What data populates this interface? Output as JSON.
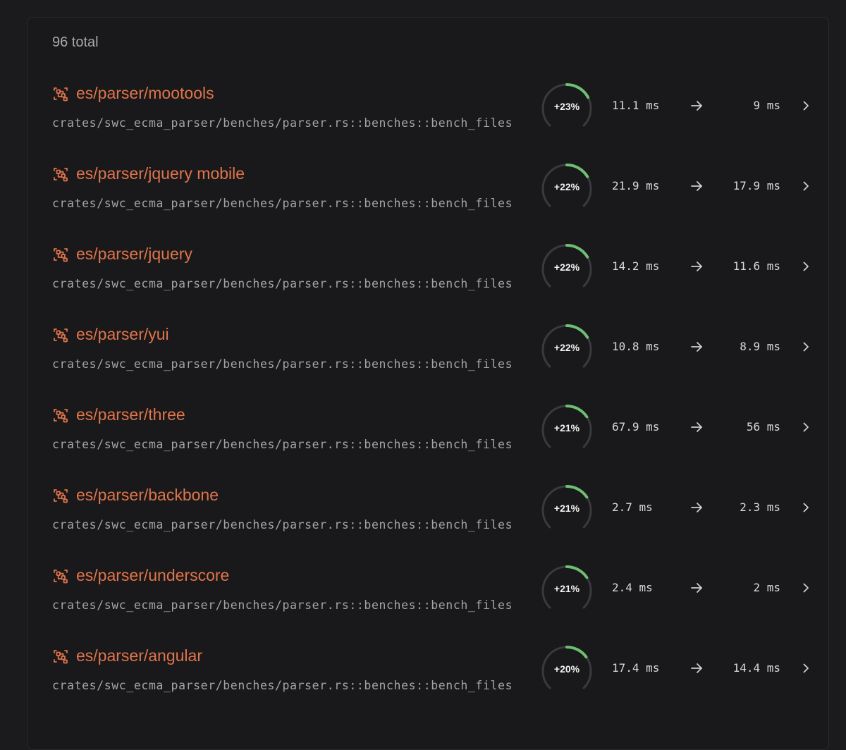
{
  "summary": {
    "total_label": "96 total"
  },
  "colors": {
    "accent": "#e0744a",
    "gauge_fill": "#6fbf73",
    "gauge_track": "#3a3a3e"
  },
  "icons": {
    "bench": "benchmark-icon",
    "arrow": "arrow-right-icon",
    "chevron": "chevron-right-icon"
  },
  "benchmarks": [
    {
      "name": "es/parser/mootools",
      "path": "crates/swc_ecma_parser/benches/parser.rs::benches::bench_files",
      "change": "+23%",
      "change_fraction": 0.23,
      "before": "11.1 ms",
      "after": "9 ms"
    },
    {
      "name": "es/parser/jquery mobile",
      "path": "crates/swc_ecma_parser/benches/parser.rs::benches::bench_files",
      "change": "+22%",
      "change_fraction": 0.22,
      "before": "21.9 ms",
      "after": "17.9 ms"
    },
    {
      "name": "es/parser/jquery",
      "path": "crates/swc_ecma_parser/benches/parser.rs::benches::bench_files",
      "change": "+22%",
      "change_fraction": 0.22,
      "before": "14.2 ms",
      "after": "11.6 ms"
    },
    {
      "name": "es/parser/yui",
      "path": "crates/swc_ecma_parser/benches/parser.rs::benches::bench_files",
      "change": "+22%",
      "change_fraction": 0.22,
      "before": "10.8 ms",
      "after": "8.9 ms"
    },
    {
      "name": "es/parser/three",
      "path": "crates/swc_ecma_parser/benches/parser.rs::benches::bench_files",
      "change": "+21%",
      "change_fraction": 0.21,
      "before": "67.9 ms",
      "after": "56 ms"
    },
    {
      "name": "es/parser/backbone",
      "path": "crates/swc_ecma_parser/benches/parser.rs::benches::bench_files",
      "change": "+21%",
      "change_fraction": 0.21,
      "before": "2.7 ms",
      "after": "2.3 ms"
    },
    {
      "name": "es/parser/underscore",
      "path": "crates/swc_ecma_parser/benches/parser.rs::benches::bench_files",
      "change": "+21%",
      "change_fraction": 0.21,
      "before": "2.4 ms",
      "after": "2 ms"
    },
    {
      "name": "es/parser/angular",
      "path": "crates/swc_ecma_parser/benches/parser.rs::benches::bench_files",
      "change": "+20%",
      "change_fraction": 0.2,
      "before": "17.4 ms",
      "after": "14.4 ms"
    }
  ]
}
